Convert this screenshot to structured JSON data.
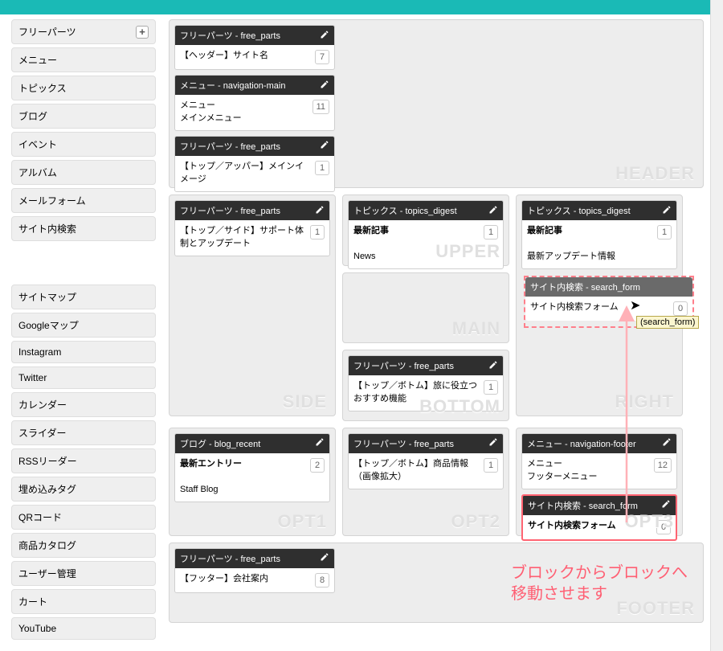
{
  "sidebar": {
    "items_top": [
      {
        "label": "フリーパーツ",
        "has_plus": true
      },
      {
        "label": "メニュー"
      },
      {
        "label": "トピックス"
      },
      {
        "label": "ブログ"
      },
      {
        "label": "イベント"
      },
      {
        "label": "アルバム"
      },
      {
        "label": "メールフォーム"
      },
      {
        "label": "サイト内検索"
      }
    ],
    "items_bottom": [
      {
        "label": "サイトマップ"
      },
      {
        "label": "Googleマップ"
      },
      {
        "label": "Instagram"
      },
      {
        "label": "Twitter"
      },
      {
        "label": "カレンダー"
      },
      {
        "label": "スライダー"
      },
      {
        "label": "RSSリーダー"
      },
      {
        "label": "埋め込みタグ"
      },
      {
        "label": "QRコード"
      },
      {
        "label": "商品カタログ"
      },
      {
        "label": "ユーザー管理"
      },
      {
        "label": "カート"
      },
      {
        "label": "YouTube"
      }
    ]
  },
  "zones": {
    "header": {
      "label": "HEADER",
      "cards": [
        {
          "head": "フリーパーツ - free_parts",
          "title": "【ヘッダー】サイト名",
          "count": "7"
        },
        {
          "head": "メニュー - navigation-main",
          "title": "メニュー",
          "sub": "メインメニュー",
          "count": "11"
        },
        {
          "head": "フリーパーツ - free_parts",
          "title": "【トップ／アッパー】メインイメージ",
          "count": "1"
        }
      ]
    },
    "side": {
      "label": "SIDE",
      "cards": [
        {
          "head": "フリーパーツ - free_parts",
          "title": "【トップ／サイド】サポート体制とアップデート",
          "count": "1"
        }
      ]
    },
    "upper": {
      "label": "UPPER",
      "cards": [
        {
          "head": "トピックス - topics_digest",
          "title": "最新記事",
          "sub": "News",
          "count": "1"
        }
      ]
    },
    "main": {
      "label": "MAIN",
      "cards": []
    },
    "bottom": {
      "label": "BOTTOM",
      "cards": [
        {
          "head": "フリーパーツ - free_parts",
          "title": "【トップ／ボトム】旅に役立つおすすめ機能",
          "count": "1"
        }
      ]
    },
    "right": {
      "label": "RIGHT",
      "cards": [
        {
          "head": "トピックス - topics_digest",
          "title": "最新記事",
          "sub": "最新アップデート情報",
          "count": "1"
        }
      ],
      "drag_card": {
        "head": "サイト内検索 - search_form",
        "title": "サイト内検索フォーム",
        "count": "0"
      }
    },
    "opt1": {
      "label": "OPT1",
      "cards": [
        {
          "head": "ブログ - blog_recent",
          "title": "最新エントリー",
          "sub": "Staff Blog",
          "count": "2"
        }
      ]
    },
    "opt2": {
      "label": "OPT2",
      "cards": [
        {
          "head": "フリーパーツ - free_parts",
          "title": "【トップ／ボトム】商品情報（画像拡大）",
          "count": "1"
        }
      ]
    },
    "opt3": {
      "label": "OPT3",
      "cards": [
        {
          "head": "メニュー - navigation-footer",
          "title": "メニュー",
          "sub": "フッターメニュー",
          "count": "12"
        }
      ],
      "placed_card": {
        "head": "サイト内検索 - search_form",
        "title": "サイト内検索フォーム",
        "count": "0"
      }
    },
    "footer": {
      "label": "FOOTER",
      "cards": [
        {
          "head": "フリーパーツ - free_parts",
          "title": "【フッター】会社案内",
          "count": "8"
        }
      ]
    }
  },
  "tooltip": "(search_form)",
  "annotation": {
    "line1": "ブロックからブロックへ",
    "line2": "移動させます"
  }
}
